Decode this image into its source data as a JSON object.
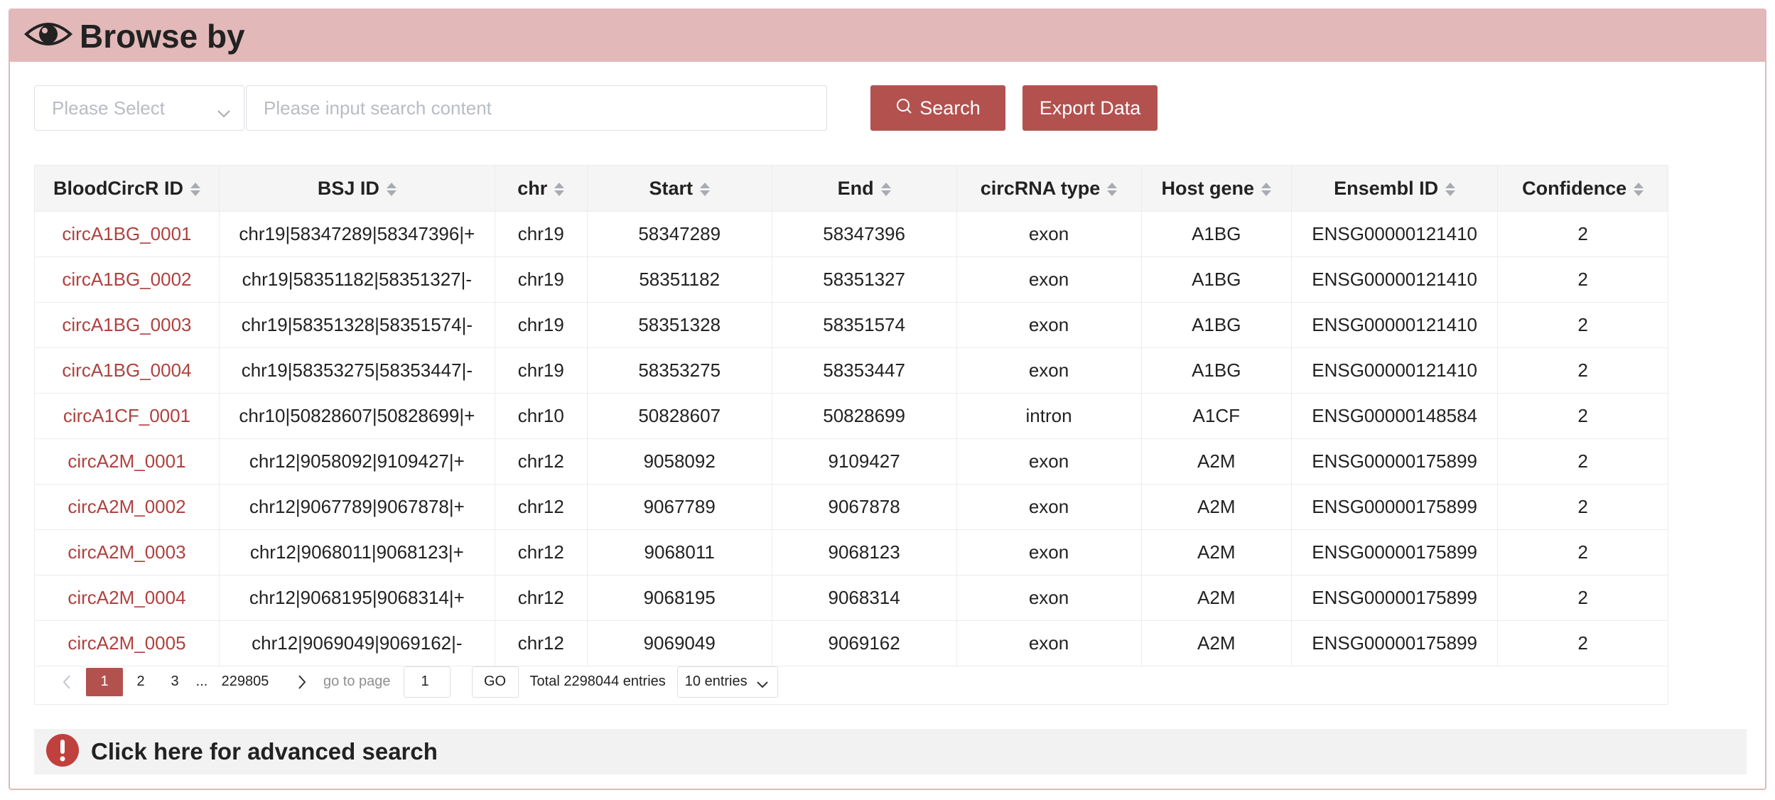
{
  "header": {
    "title": "Browse by",
    "icon": "eye-icon"
  },
  "search": {
    "select_placeholder": "Please Select",
    "input_placeholder": "Please input search content",
    "search_label": "Search",
    "export_label": "Export Data"
  },
  "table": {
    "columns": [
      "BloodCircR ID",
      "BSJ ID",
      "chr",
      "Start",
      "End",
      "circRNA type",
      "Host gene",
      "Ensembl ID",
      "Confidence"
    ],
    "rows": [
      [
        "circA1BG_0001",
        "chr19|58347289|58347396|+",
        "chr19",
        "58347289",
        "58347396",
        "exon",
        "A1BG",
        "ENSG00000121410",
        "2"
      ],
      [
        "circA1BG_0002",
        "chr19|58351182|58351327|-",
        "chr19",
        "58351182",
        "58351327",
        "exon",
        "A1BG",
        "ENSG00000121410",
        "2"
      ],
      [
        "circA1BG_0003",
        "chr19|58351328|58351574|-",
        "chr19",
        "58351328",
        "58351574",
        "exon",
        "A1BG",
        "ENSG00000121410",
        "2"
      ],
      [
        "circA1BG_0004",
        "chr19|58353275|58353447|-",
        "chr19",
        "58353275",
        "58353447",
        "exon",
        "A1BG",
        "ENSG00000121410",
        "2"
      ],
      [
        "circA1CF_0001",
        "chr10|50828607|50828699|+",
        "chr10",
        "50828607",
        "50828699",
        "intron",
        "A1CF",
        "ENSG00000148584",
        "2"
      ],
      [
        "circA2M_0001",
        "chr12|9058092|9109427|+",
        "chr12",
        "9058092",
        "9109427",
        "exon",
        "A2M",
        "ENSG00000175899",
        "2"
      ],
      [
        "circA2M_0002",
        "chr12|9067789|9067878|+",
        "chr12",
        "9067789",
        "9067878",
        "exon",
        "A2M",
        "ENSG00000175899",
        "2"
      ],
      [
        "circA2M_0003",
        "chr12|9068011|9068123|+",
        "chr12",
        "9068011",
        "9068123",
        "exon",
        "A2M",
        "ENSG00000175899",
        "2"
      ],
      [
        "circA2M_0004",
        "chr12|9068195|9068314|+",
        "chr12",
        "9068195",
        "9068314",
        "exon",
        "A2M",
        "ENSG00000175899",
        "2"
      ],
      [
        "circA2M_0005",
        "chr12|9069049|9069162|-",
        "chr12",
        "9069049",
        "9069162",
        "exon",
        "A2M",
        "ENSG00000175899",
        "2"
      ]
    ]
  },
  "pagination": {
    "pages": [
      "1",
      "2",
      "3"
    ],
    "ellipsis": "...",
    "last_page": "229805",
    "current_page": "1",
    "goto_label": "go to page",
    "goto_value": "1",
    "go_label": "GO",
    "total": "Total 2298044 entries",
    "page_size": "10 entries"
  },
  "advanced": {
    "label": "Click here for advanced search"
  },
  "colors": {
    "header_bg": "#e2b8b8",
    "accent": "#b3514f",
    "link": "#b0413e"
  }
}
